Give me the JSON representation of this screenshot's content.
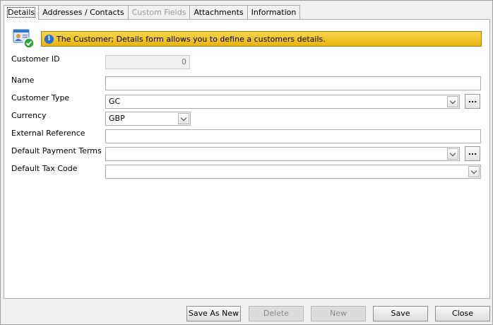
{
  "tabs": [
    {
      "label": "Details",
      "state": "active"
    },
    {
      "label": "Addresses / Contacts",
      "state": "normal"
    },
    {
      "label": "Custom Fields",
      "state": "disabled"
    },
    {
      "label": "Attachments",
      "state": "normal"
    },
    {
      "label": "Information",
      "state": "normal"
    }
  ],
  "header": {
    "icon": "customer-card-check-icon",
    "info_icon": "info-icon",
    "message": "The Customer; Details form allows you to define a customers details.",
    "banner_color": "#f2c521"
  },
  "form": {
    "customer_id": {
      "label": "Customer ID",
      "value": "0"
    },
    "name": {
      "label": "Name",
      "value": ""
    },
    "customer_type": {
      "label": "Customer Type",
      "value": "GC"
    },
    "currency": {
      "label": "Currency",
      "value": "GBP"
    },
    "external_reference": {
      "label": "External Reference",
      "value": ""
    },
    "default_payment_terms": {
      "label": "Default Payment Terms",
      "value": ""
    },
    "default_tax_code": {
      "label": "Default Tax Code",
      "value": ""
    },
    "ellipsis_label": "..."
  },
  "buttons": {
    "save_as_new": "Save As New",
    "delete": "Delete",
    "new": "New",
    "save": "Save",
    "close": "Close"
  }
}
